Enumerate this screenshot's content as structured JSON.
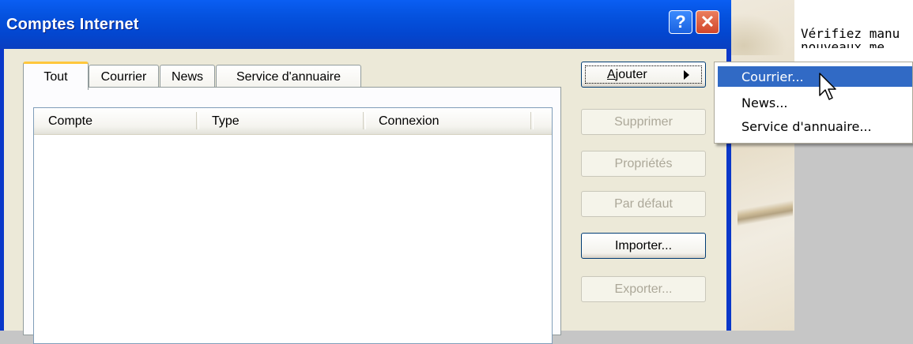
{
  "background_window": {
    "text_line1": "Vérifiez manu",
    "text_line2": "nouveaux me"
  },
  "dialog": {
    "title": "Comptes Internet",
    "help_label": "?",
    "close_label": "✕",
    "tabs": [
      {
        "label": "Tout",
        "active": true
      },
      {
        "label": "Courrier",
        "active": false
      },
      {
        "label": "News",
        "active": false
      },
      {
        "label": "Service d'annuaire",
        "active": false
      }
    ],
    "list_columns": [
      "Compte",
      "Type",
      "Connexion"
    ],
    "buttons": {
      "ajouter_prefix": "A",
      "ajouter_rest": "jouter",
      "supprimer": "Supprimer",
      "proprietes": "Propriétés",
      "par_defaut": "Par défaut",
      "importer": "Importer...",
      "exporter": "Exporter..."
    }
  },
  "popup_menu": {
    "items": [
      "Courrier...",
      "News...",
      "Service d'annuaire..."
    ],
    "highlighted": 0
  },
  "colors": {
    "title_bar": "#0553e0",
    "menu_highlight": "#316ac5",
    "active_tab_accent": "#ffc73c"
  }
}
